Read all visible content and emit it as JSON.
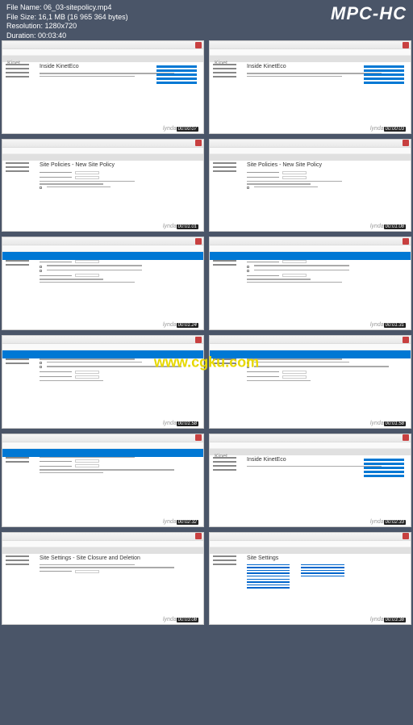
{
  "header": {
    "filename_label": "File Name:",
    "filename": "06_03-sitepolicy.mp4",
    "filesize_label": "File Size:",
    "filesize": "16,1 MB (16 965 364 bytes)",
    "resolution_label": "Resolution:",
    "resolution": "1280x720",
    "duration_label": "Duration:",
    "duration": "00:03:40",
    "player": "MPC-HC"
  },
  "watermark": "www.cgku.com",
  "brand": "lynda",
  "thumbnails": [
    {
      "title": "Inside KinetEco",
      "tc": "00:00:07",
      "type": "kinet"
    },
    {
      "title": "Inside KinetEco",
      "tc": "00:00:03",
      "type": "kinet"
    },
    {
      "title": "Site Policies - New Site Policy",
      "tc": "00:01:01",
      "type": "policy"
    },
    {
      "title": "Site Policies - New Site Policy",
      "tc": "00:01:08",
      "type": "policy"
    },
    {
      "title": "",
      "tc": "00:01:24",
      "type": "blueform"
    },
    {
      "title": "",
      "tc": "00:01:31",
      "type": "blueform"
    },
    {
      "title": "",
      "tc": "00:01:58",
      "type": "blueform"
    },
    {
      "title": "",
      "tc": "00:01:58",
      "type": "blueform"
    },
    {
      "title": "",
      "tc": "00:02:32",
      "type": "blueform"
    },
    {
      "title": "Inside KinetEco",
      "tc": "00:02:33",
      "type": "kinet"
    },
    {
      "title": "Site Settings - Site Closure and Deletion",
      "tc": "00:03:08",
      "type": "closure"
    },
    {
      "title": "Site Settings",
      "tc": "00:03:38",
      "type": "settings"
    }
  ]
}
